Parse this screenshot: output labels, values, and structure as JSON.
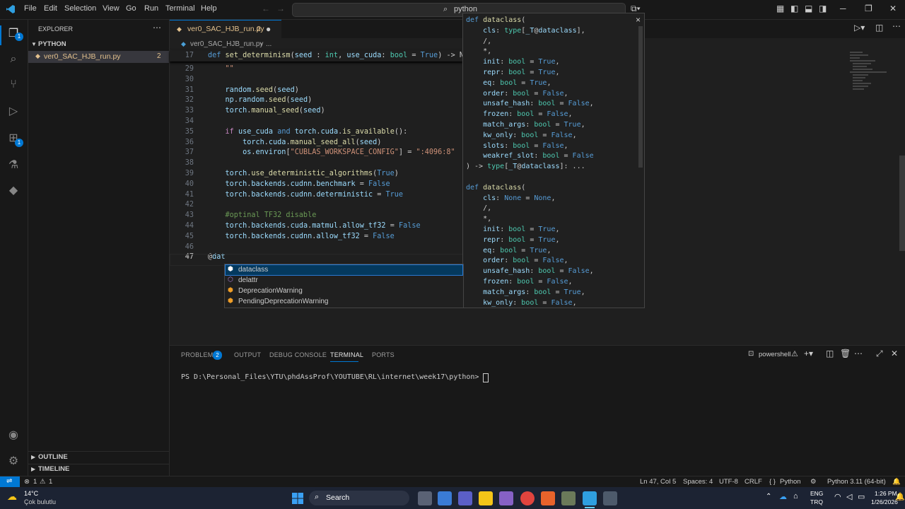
{
  "titlebar": {
    "menu": [
      "File",
      "Edit",
      "Selection",
      "View",
      "Go",
      "Run",
      "Terminal",
      "Help"
    ],
    "search": "python"
  },
  "activity": {
    "explorer_badge": "1",
    "extensions_badge": "1"
  },
  "sidebar": {
    "title": "EXPLORER",
    "folder": "PYTHON",
    "file": "ver0_SAC_HJB_run.py",
    "file_problems": "2",
    "outline": "OUTLINE",
    "timeline": "TIMELINE"
  },
  "tab": {
    "label": "ver0_SAC_HJB_run.py",
    "problems": "2"
  },
  "breadcrumb": {
    "file": "ver0_SAC_HJB_run.py",
    "more": "..."
  },
  "code": {
    "sticky_num": "17",
    "sticky": "def set_determinism(seed : int, use_cuda: bool = True) -> No",
    "lines": [
      {
        "n": "29",
        "t": "    \"\"\""
      },
      {
        "n": "30",
        "t": ""
      },
      {
        "n": "31",
        "t": "    random.seed(seed)"
      },
      {
        "n": "32",
        "t": "    np.random.seed(seed)"
      },
      {
        "n": "33",
        "t": "    torch.manual_seed(seed)"
      },
      {
        "n": "34",
        "t": ""
      },
      {
        "n": "35",
        "t": "    if use_cuda and torch.cuda.is_available():"
      },
      {
        "n": "36",
        "t": "        torch.cuda.manual_seed_all(seed)"
      },
      {
        "n": "37",
        "t": "        os.environ[\"CUBLAS_WORKSPACE_CONFIG\"] = \":4096:8\""
      },
      {
        "n": "38",
        "t": ""
      },
      {
        "n": "39",
        "t": "    torch.use_deterministic_algorithms(True)"
      },
      {
        "n": "40",
        "t": "    torch.backends.cudnn.benchmark = False"
      },
      {
        "n": "41",
        "t": "    torch.backends.cudnn.deterministic = True"
      },
      {
        "n": "42",
        "t": ""
      },
      {
        "n": "43",
        "t": "    #optinal TF32 disable"
      },
      {
        "n": "44",
        "t": "    torch.backends.cuda.matmul.allow_tf32 = False"
      },
      {
        "n": "45",
        "t": "    torch.backends.cudnn.allow_tf32 = False"
      },
      {
        "n": "46",
        "t": ""
      },
      {
        "n": "47",
        "t": "@dat"
      }
    ]
  },
  "hover": {
    "lines": [
      "def dataclass(",
      "    cls: type[_T@dataclass],",
      "    /,",
      "    *,",
      "    init: bool = True,",
      "    repr: bool = True,",
      "    eq: bool = True,",
      "    order: bool = False,",
      "    unsafe_hash: bool = False,",
      "    frozen: bool = False,",
      "    match_args: bool = True,",
      "    kw_only: bool = False,",
      "    slots: bool = False,",
      "    weakref_slot: bool = False",
      ") -> type[_T@dataclass]: ...",
      "",
      "def dataclass(",
      "    cls: None = None,",
      "    /,",
      "    *,",
      "    init: bool = True,",
      "    repr: bool = True,",
      "    eq: bool = True,",
      "    order: bool = False,",
      "    unsafe_hash: bool = False,",
      "    frozen: bool = False,",
      "    match_args: bool = True,",
      "    kw_only: bool = False,"
    ],
    "close": "×"
  },
  "suggest": [
    {
      "label": "dataclass",
      "icon": "class-icon"
    },
    {
      "label": "delattr",
      "icon": "function-icon"
    },
    {
      "label": "DeprecationWarning",
      "icon": "class-icon"
    },
    {
      "label": "PendingDeprecationWarning",
      "icon": "class-icon"
    }
  ],
  "panel": {
    "tabs": [
      "PROBLEMS",
      "OUTPUT",
      "DEBUG CONSOLE",
      "TERMINAL",
      "PORTS"
    ],
    "problems_count": "2",
    "shell": "powershell",
    "prompt": "PS D:\\Personal_Files\\YTU\\phdAssProf\\YOUTUBE\\RL\\internet\\week17\\python> "
  },
  "status": {
    "errors": "1",
    "warnings": "1",
    "position": "Ln 47, Col 5",
    "spaces": "Spaces: 4",
    "encoding": "UTF-8",
    "eol": "CRLF",
    "language": "Python",
    "interpreter": "Python 3.11 (64-bit)",
    "language_braces": "{ }"
  },
  "taskbar": {
    "temp": "14°C",
    "weather": "Çok bulutlu",
    "search": "Search",
    "lang1": "ENG",
    "lang2": "TRQ",
    "time": "1:26 PM",
    "date": "1/26/2026"
  },
  "colors": {
    "accent": "#0078d4",
    "keyword": "#569cd6",
    "function": "#dcdcaa",
    "string": "#ce9178",
    "comment": "#6a9955",
    "error": "#f14c4c",
    "modified_file": "#e2c08d"
  }
}
